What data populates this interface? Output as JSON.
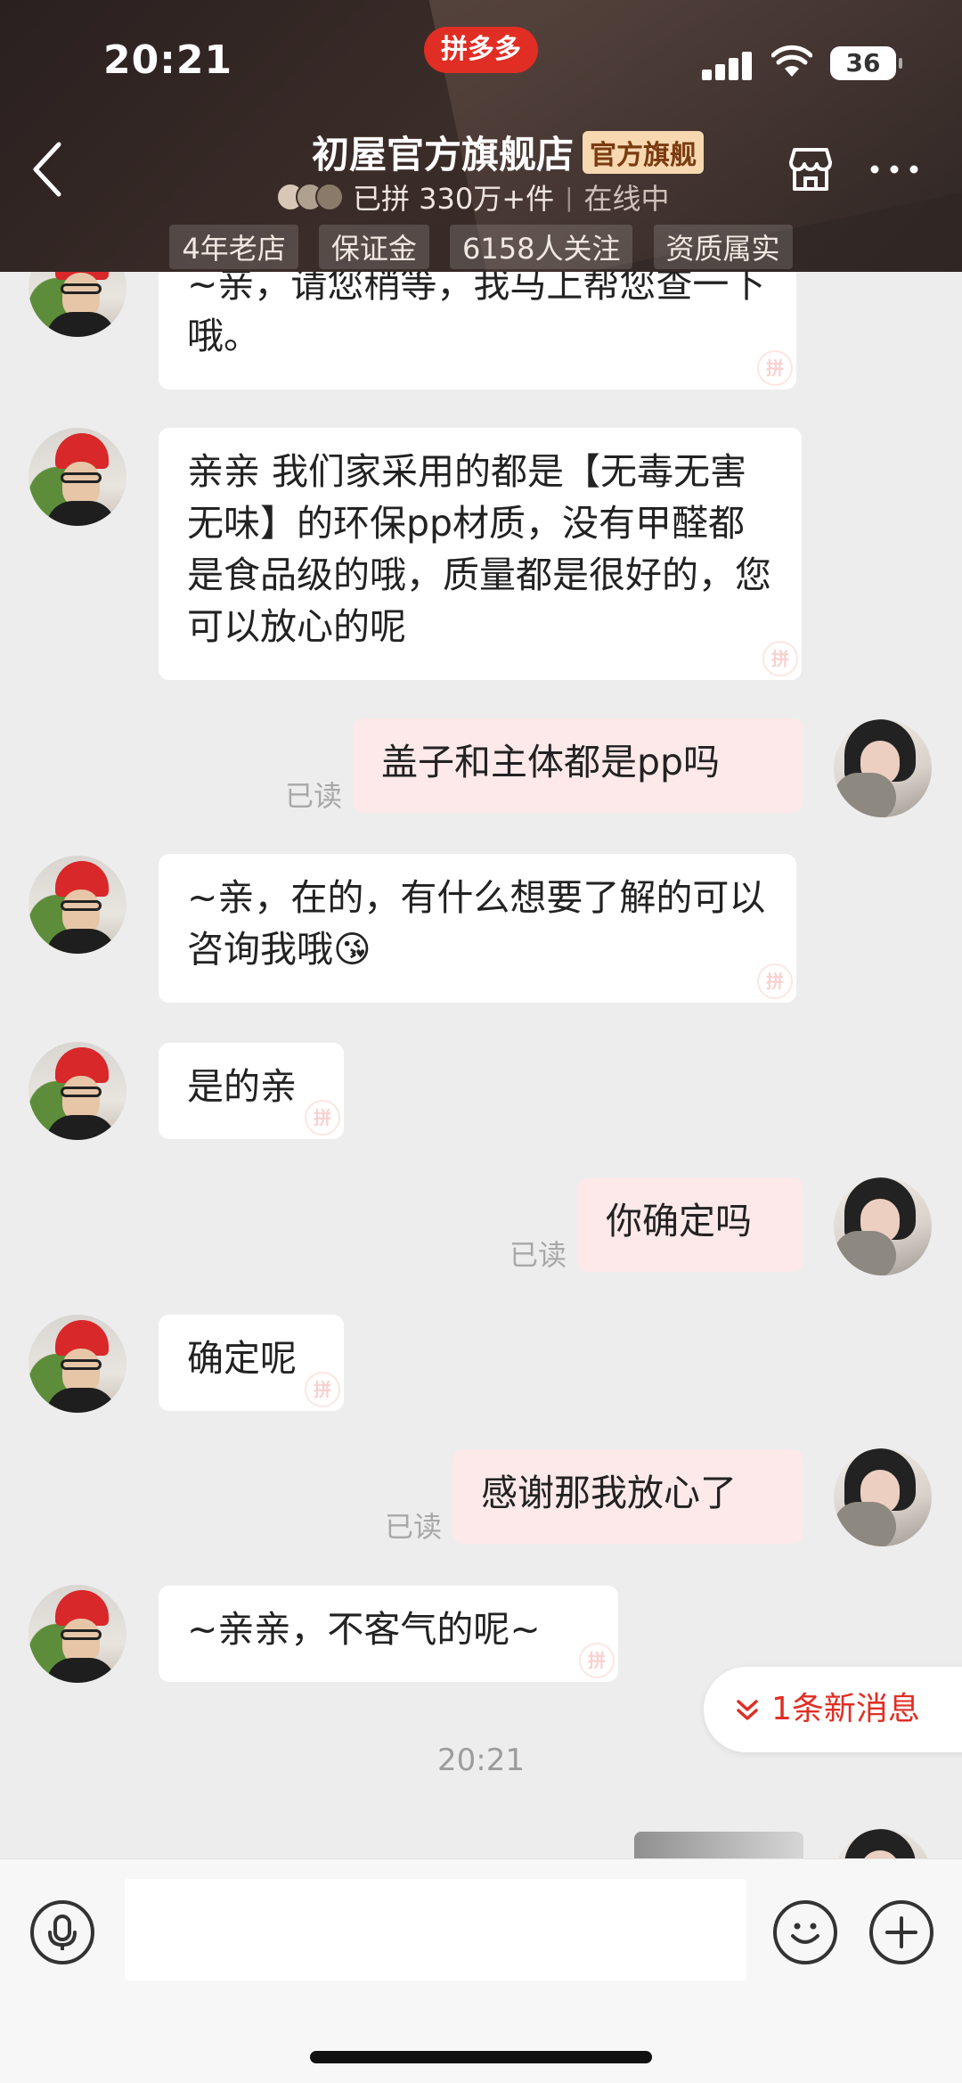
{
  "status_bar": {
    "time": "20:21",
    "badge": "拼多多",
    "battery": "36"
  },
  "header": {
    "shop_name": "初屋官方旗舰店",
    "official_tag": "官方旗舰",
    "sold": "已拼 330万+件",
    "separator": "|",
    "online": "在线中",
    "tags": [
      "4年老店",
      "保证金",
      "6158人关注",
      "资质属实"
    ]
  },
  "messages": [
    {
      "sender": "seller",
      "text": "~亲，请您稍等，我马上帮您查一下哦。"
    },
    {
      "sender": "seller",
      "text": "亲亲 我们家采用的都是【无毒无害无味】的环保pp材质，没有甲醛都是食品级的哦，质量都是很好的，您可以放心的呢"
    },
    {
      "sender": "buyer",
      "text": "盖子和主体都是pp吗",
      "read": "已读"
    },
    {
      "sender": "seller",
      "text": "~亲，在的，有什么想要了解的可以咨询我哦😘"
    },
    {
      "sender": "seller",
      "text": "是的亲"
    },
    {
      "sender": "buyer",
      "text": "你确定吗",
      "read": "已读"
    },
    {
      "sender": "seller",
      "text": "确定呢"
    },
    {
      "sender": "buyer",
      "text": "感谢那我放心了",
      "read": "已读"
    },
    {
      "sender": "seller",
      "text": "~亲亲，不客气的呢~"
    }
  ],
  "timestamp": "20:21",
  "new_message_label": "1条新消息",
  "watermark": "拼",
  "input": {
    "placeholder": ""
  },
  "icons": {
    "back": "chevron-left-icon",
    "shop": "storefront-icon",
    "more": "more-dots-icon",
    "voice": "microphone-icon",
    "emoji": "smiley-icon",
    "plus": "plus-icon",
    "new_msg": "double-chevron-down-icon"
  },
  "colors": {
    "brand_red": "#e02e24",
    "bubble_mine": "#fde9e9",
    "bubble_other": "#ffffff",
    "chat_bg": "#ededed"
  }
}
